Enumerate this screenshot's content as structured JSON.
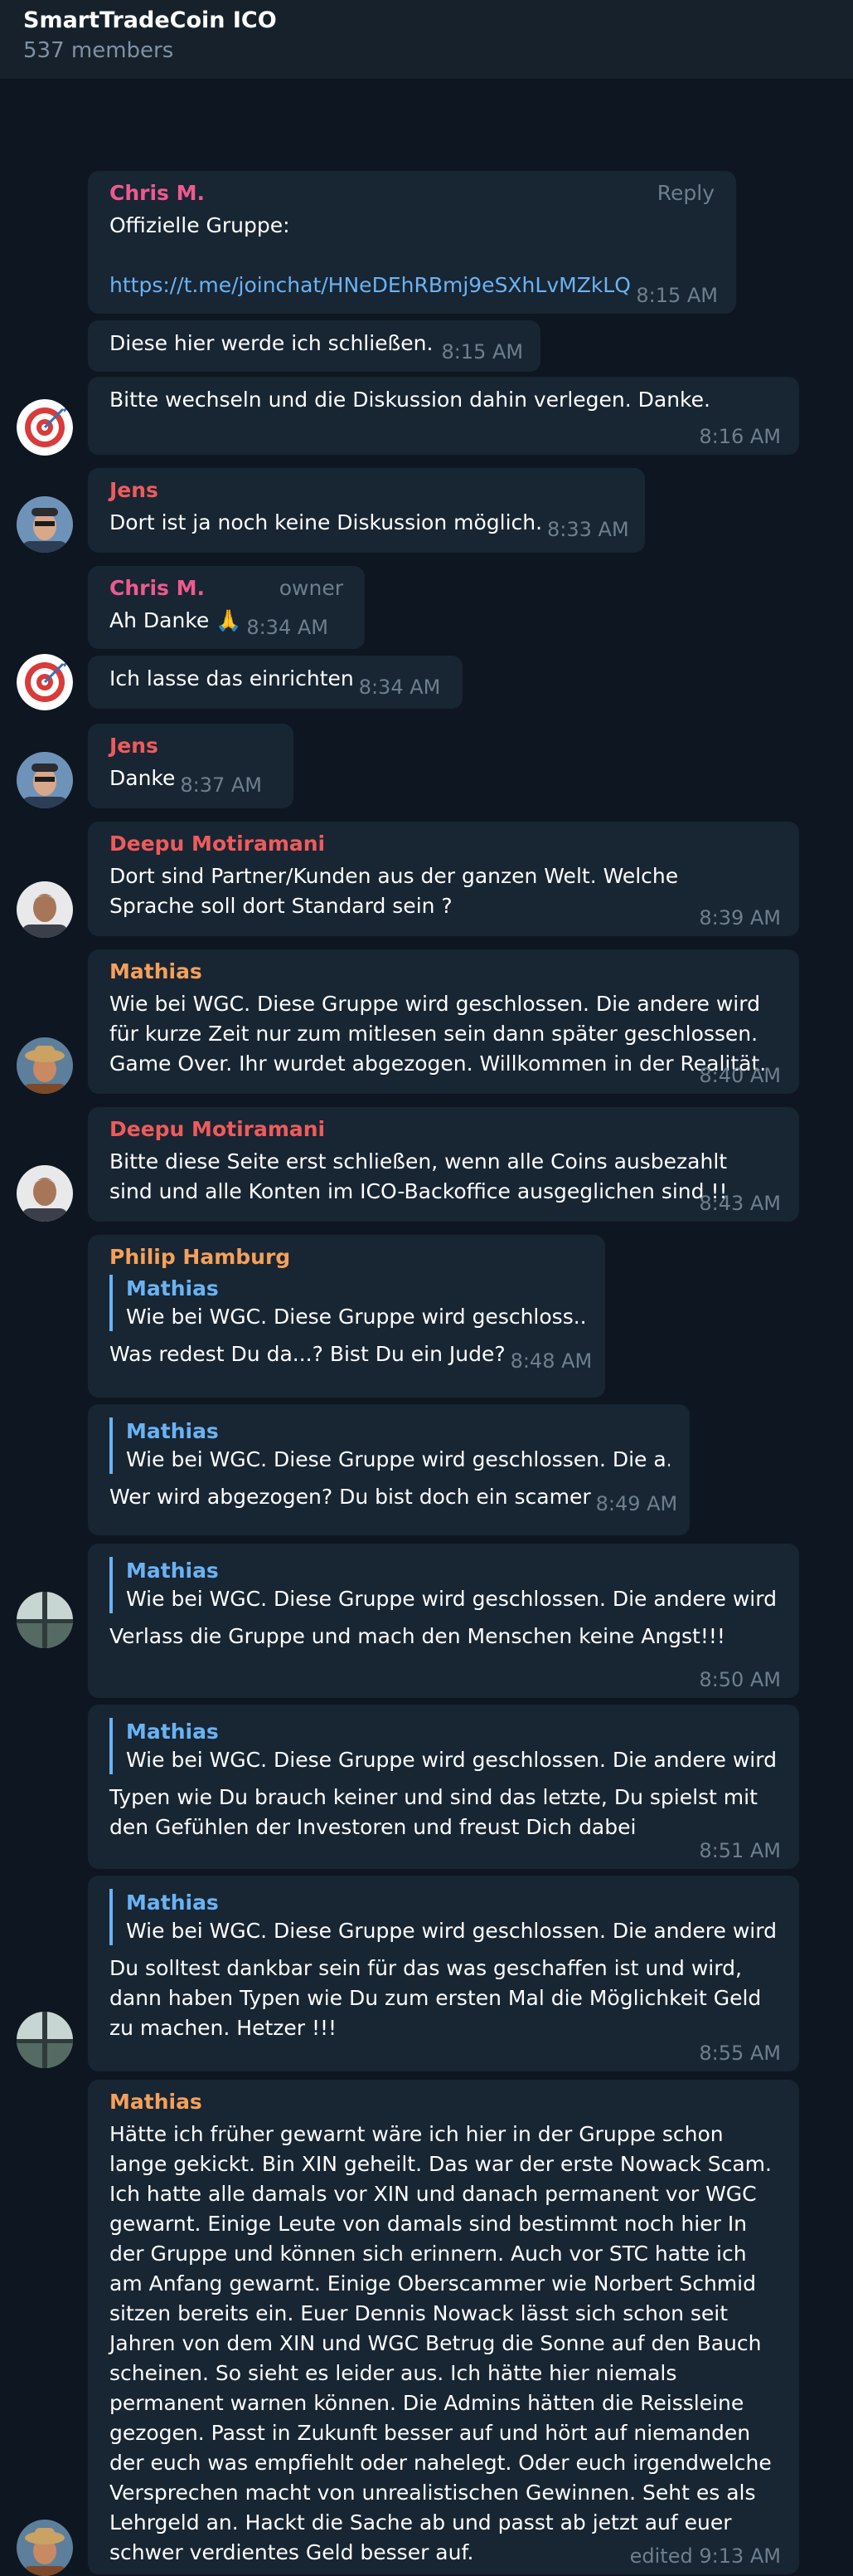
{
  "header": {
    "title": "SmartTradeCoin ICO",
    "members": "537 members"
  },
  "colors": {
    "pink": "#ee5a8e",
    "red": "#ef5b5b",
    "orange": "#f5a05a",
    "blue": "#6ab3f3"
  },
  "messages": [
    {
      "id": "m1",
      "sender": "Chris M.",
      "tag": "Reply",
      "line1": "Offizielle Gruppe:",
      "link": "https://t.me/joinchat/HNeDEhRBmj9eSXhLvMZkLQ",
      "time": "8:15 AM"
    },
    {
      "id": "m2",
      "text": "Diese hier werde ich schließen.",
      "time": "8:15 AM"
    },
    {
      "id": "m3",
      "text": "Bitte wechseln und die Diskussion dahin verlegen. Danke.",
      "time": "8:16 AM"
    },
    {
      "id": "m4",
      "sender": "Jens",
      "text": "Dort ist ja noch keine Diskussion möglich.",
      "time": "8:33 AM"
    },
    {
      "id": "m5",
      "sender": "Chris M.",
      "tag": "owner",
      "text": "Ah Danke 🙏",
      "time": "8:34 AM"
    },
    {
      "id": "m6",
      "text": "Ich lasse das einrichten",
      "time": "8:34 AM"
    },
    {
      "id": "m7",
      "sender": "Jens",
      "text": "Danke",
      "time": "8:37 AM"
    },
    {
      "id": "m8",
      "sender": "Deepu Motiramani",
      "text": "Dort sind Partner/Kunden aus der ganzen Welt. Welche Sprache soll dort Standard sein ?",
      "time": "8:39 AM"
    },
    {
      "id": "m9",
      "sender": "Mathias",
      "text": "Wie bei WGC. Diese Gruppe wird geschlossen. Die andere wird für kurze Zeit nur zum mitlesen sein dann später geschlossen. Game Over. Ihr wurdet abgezogen. Willkommen in der Realität.",
      "time": "8:40 AM"
    },
    {
      "id": "m10",
      "sender": "Deepu Motiramani",
      "text": "Bitte diese Seite erst schließen, wenn alle Coins ausbezahlt sind und alle Konten im ICO-Backoffice ausgeglichen sind !!",
      "time": "8:43 AM"
    },
    {
      "id": "m11",
      "sender": "Philip Hamburg",
      "quote_name": "Mathias",
      "quote_text": "Wie bei WGC. Diese Gruppe wird geschloss...",
      "text": "Was redest Du da...? Bist Du ein Jude?",
      "time": "8:48 AM"
    },
    {
      "id": "m12",
      "quote_name": "Mathias",
      "quote_text": "Wie bei WGC. Diese Gruppe wird geschlossen. Die a...",
      "text": "Wer wird abgezogen? Du bist doch ein scamer",
      "time": "8:49 AM"
    },
    {
      "id": "m13",
      "quote_name": "Mathias",
      "quote_text": "Wie bei WGC. Diese Gruppe wird geschlossen. Die andere wird ...",
      "text": "Verlass die Gruppe und mach den Menschen keine Angst!!!",
      "time": "8:50 AM"
    },
    {
      "id": "m14",
      "quote_name": "Mathias",
      "quote_text": "Wie bei WGC. Diese Gruppe wird geschlossen. Die andere wird ...",
      "text": "Typen wie Du brauch keiner und sind das letzte, Du spielst mit den Gefühlen der Investoren und freust Dich dabei",
      "time": "8:51 AM"
    },
    {
      "id": "m15",
      "quote_name": "Mathias",
      "quote_text": "Wie bei WGC. Diese Gruppe wird geschlossen. Die andere wird ...",
      "text": "Du solltest dankbar sein für das was geschaffen ist und wird, dann haben Typen wie Du zum ersten Mal die Möglichkeit Geld zu machen. Hetzer !!!",
      "time": "8:55 AM"
    },
    {
      "id": "m16",
      "sender": "Mathias",
      "text": "Hätte ich früher gewarnt wäre ich hier in der Gruppe schon lange gekickt. Bin XIN geheilt. Das war der erste Nowack Scam. Ich hatte alle damals vor XIN und danach permanent vor WGC gewarnt. Einige Leute von damals sind bestimmt noch hier In der Gruppe und können sich erinnern. Auch vor STC hatte ich am Anfang gewarnt. Einige Oberscammer wie Norbert Schmid sitzen bereits ein. Euer Dennis Nowack lässt sich schon seit Jahren von dem XIN und WGC Betrug die Sonne auf den Bauch scheinen. So sieht es leider aus. Ich hätte hier niemals permanent warnen können. Die Admins hätten die Reissleine gezogen. Passt in Zukunft besser auf und hört auf niemanden der euch was empfiehlt oder nahelegt. Oder euch irgendwelche Versprechen macht von unrealistischen Gewinnen. Seht es als Lehrgeld an. Hackt die Sache ab und passt ab jetzt auf euer schwer verdientes Geld besser auf.",
      "time": "edited 9:13 AM"
    }
  ]
}
